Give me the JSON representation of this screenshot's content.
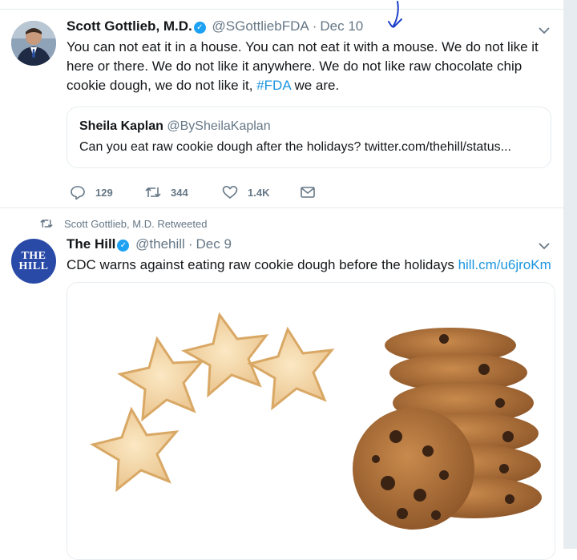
{
  "tweet1": {
    "author_name": "Scott Gottlieb, M.D.",
    "handle": "@SGottliebFDA",
    "date": "Dec 10",
    "text_before": "You can not eat it in a house. You can not eat it with a mouse. We do not like it here or there. We do not like it anywhere. We do not like raw chocolate chip cookie dough, we do not like it, ",
    "hashtag": "#FDA",
    "text_after": " we are.",
    "quote": {
      "author_name": "Sheila Kaplan",
      "handle": "@BySheilaKaplan",
      "text": "Can you eat raw cookie dough after the holidays? twitter.com/thehill/status..."
    },
    "actions": {
      "reply_count": "129",
      "retweet_count": "344",
      "like_count": "1.4K"
    }
  },
  "retweet_note": "Scott Gottlieb, M.D. Retweeted",
  "tweet2": {
    "avatar_line1": "THE",
    "avatar_line2": "HILL",
    "author_name": "The Hill",
    "handle": "@thehill",
    "date": "Dec 9",
    "text": "CDC warns against eating raw cookie dough before the holidays ",
    "link": "hill.cm/u6jroKm"
  },
  "icons": {
    "reply": "reply-icon",
    "retweet": "retweet-icon",
    "like": "heart-icon",
    "dm": "envelope-icon",
    "verified": "verified-badge-icon",
    "menu": "chevron-down-icon"
  },
  "colors": {
    "link": "#1b95e0",
    "verified": "#1da1f2",
    "muted": "#657786",
    "border": "#e6ecf0",
    "pen_mark": "#1a3fc9"
  }
}
